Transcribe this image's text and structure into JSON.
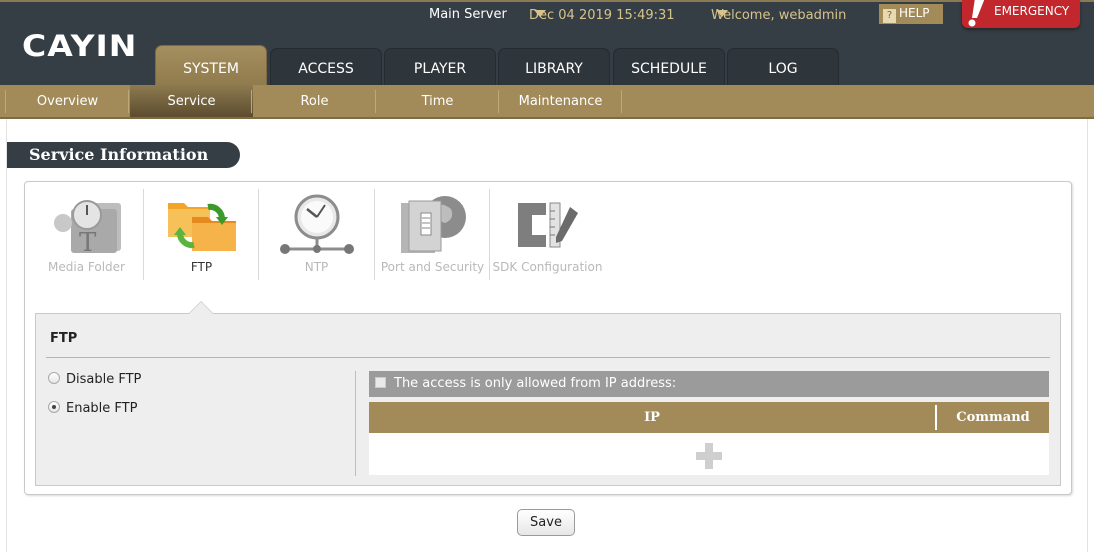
{
  "header": {
    "logo": "CAYIN",
    "server": "Main Server",
    "datetime": "Dec 04 2019 15:49:31",
    "welcome": "Welcome, webadmin",
    "help_label": "HELP",
    "help_icon_glyph": "?",
    "emergency_label": "EMERGENCY"
  },
  "main_tabs": [
    {
      "label": "SYSTEM",
      "active": true
    },
    {
      "label": "ACCESS"
    },
    {
      "label": "PLAYER"
    },
    {
      "label": "LIBRARY"
    },
    {
      "label": "SCHEDULE"
    },
    {
      "label": "LOG"
    }
  ],
  "sub_tabs": [
    {
      "label": "Overview"
    },
    {
      "label": "Service",
      "active": true
    },
    {
      "label": "Role"
    },
    {
      "label": "Time"
    },
    {
      "label": "Maintenance"
    }
  ],
  "section_title": "Service Information",
  "services": [
    {
      "label": "Media Folder",
      "icon": "media-folder-icon"
    },
    {
      "label": "FTP",
      "icon": "ftp-sync-folders-icon",
      "active": true
    },
    {
      "label": "NTP",
      "icon": "ntp-clock-icon"
    },
    {
      "label": "Port and Security",
      "icon": "server-globe-icon"
    },
    {
      "label": "SDK Configuration",
      "icon": "sdk-tools-icon"
    }
  ],
  "ftp": {
    "heading": "FTP",
    "options": [
      {
        "label": "Disable FTP",
        "checked": false
      },
      {
        "label": "Enable FTP",
        "checked": true
      }
    ],
    "restrict_label": "The access is only allowed from IP address:",
    "restrict_checked": false,
    "table": {
      "columns": [
        "IP",
        "Command"
      ],
      "rows": []
    }
  },
  "save_label": "Save",
  "colors": {
    "header_bg": "#363e45",
    "accent_gold": "#a28b59",
    "emergency_red": "#c1272d"
  }
}
